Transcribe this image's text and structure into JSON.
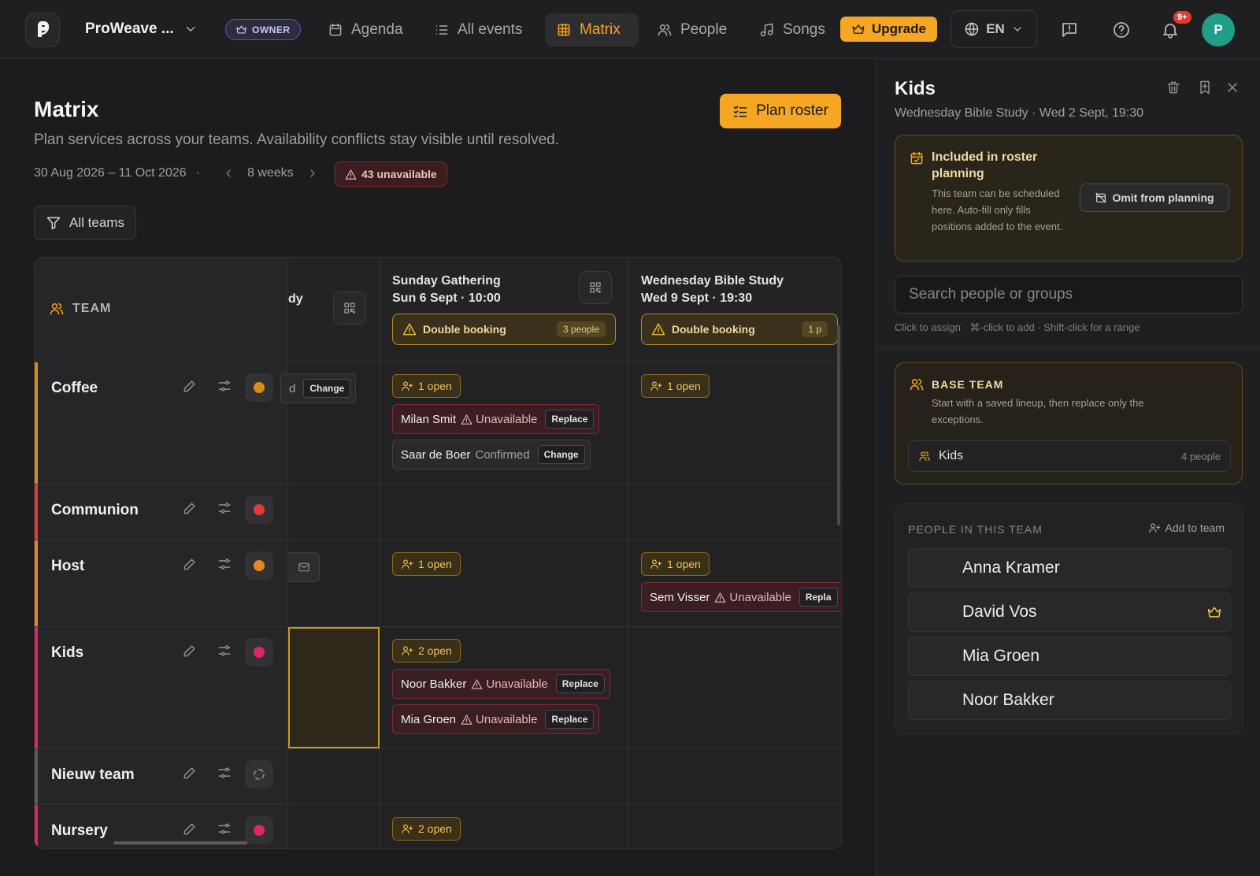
{
  "nav": {
    "org_name": "ProWeave ...",
    "owner_badge": "OWNER",
    "items": [
      {
        "label": "Agenda",
        "icon": "calendar-icon"
      },
      {
        "label": "All events",
        "icon": "list-icon"
      },
      {
        "label": "Matrix",
        "icon": "grid-icon",
        "active": true
      },
      {
        "label": "People",
        "icon": "people-icon"
      },
      {
        "label": "Songs",
        "icon": "music-icon"
      }
    ],
    "upgrade_label": "Upgrade",
    "language": "EN",
    "notifications_badge": "9+",
    "avatar_initial": "P"
  },
  "page": {
    "title": "Matrix",
    "subtitle": "Plan services across your teams. Availability conflicts stay visible until resolved.",
    "date_range": "30 Aug 2026 – 11 Oct 2026",
    "range_sep": "·",
    "weeks": "8 weeks",
    "unavailable": "43 unavailable",
    "plan_roster": "Plan roster",
    "filter": "All teams"
  },
  "matrix": {
    "team_header": "TEAM",
    "partial_col": {
      "title": "dy",
      "change": "Change",
      "status_fragment": "d"
    },
    "events": [
      {
        "title": "Sunday Gathering",
        "date": "Sun 6 Sept · 10:00",
        "conflict": "Double booking",
        "conflict_count": "3 people"
      },
      {
        "title": "Wednesday Bible Study",
        "date": "Wed 9 Sept · 19:30",
        "conflict": "Double booking",
        "conflict_count": "1 p"
      }
    ],
    "teams": [
      {
        "name": "Coffee",
        "color": "#d98a1c"
      },
      {
        "name": "Communion",
        "color": "#e53935"
      },
      {
        "name": "Host",
        "color": "#e8861f"
      },
      {
        "name": "Kids",
        "color": "#e0246b"
      },
      {
        "name": "Nieuw team",
        "color": "#5a5a5e"
      },
      {
        "name": "Nursery",
        "color": "#e0246b"
      }
    ],
    "cells": {
      "coffee_sun_open": "1 open",
      "coffee_sun_a1": {
        "name": "Milan Smit",
        "status": "Unavailable",
        "action": "Replace"
      },
      "coffee_sun_a2": {
        "name": "Saar de Boer",
        "status": "Confirmed",
        "action": "Change"
      },
      "coffee_wed_open": "1 open",
      "host_sun_open": "1 open",
      "host_wed_open": "1 open",
      "host_wed_a1": {
        "name": "Sem Visser",
        "status": "Unavailable",
        "action": "Repla"
      },
      "kids_sun_open": "2 open",
      "kids_sun_a1": {
        "name": "Noor Bakker",
        "status": "Unavailable",
        "action": "Replace"
      },
      "kids_sun_a2": {
        "name": "Mia Groen",
        "status": "Unavailable",
        "action": "Replace"
      },
      "nursery_sun_open": "2 open"
    }
  },
  "panel": {
    "title": "Kids",
    "subtitle": "Wednesday Bible Study · Wed 2 Sept, 19:30",
    "roster": {
      "title": "Included in roster planning",
      "description": "This team can be scheduled here. Auto-fill only fills positions added to the event.",
      "omit_label": "Omit from planning"
    },
    "search_placeholder": "Search people or groups",
    "hint": "Click to assign · ⌘-click to add · Shift-click for a range",
    "base_team": {
      "title": "BASE TEAM",
      "description": "Start with a saved lineup, then replace only the exceptions.",
      "lineup_name": "Kids",
      "lineup_count": "4 people"
    },
    "members": {
      "title": "PEOPLE IN THIS TEAM",
      "add_label": "Add to team",
      "list": [
        "Anna Kramer",
        "David Vos",
        "Mia Groen",
        "Noor Bakker"
      ]
    }
  },
  "colors": {
    "accent": "#f5a623",
    "danger": "#e53935",
    "background": "#1c1c1e"
  }
}
